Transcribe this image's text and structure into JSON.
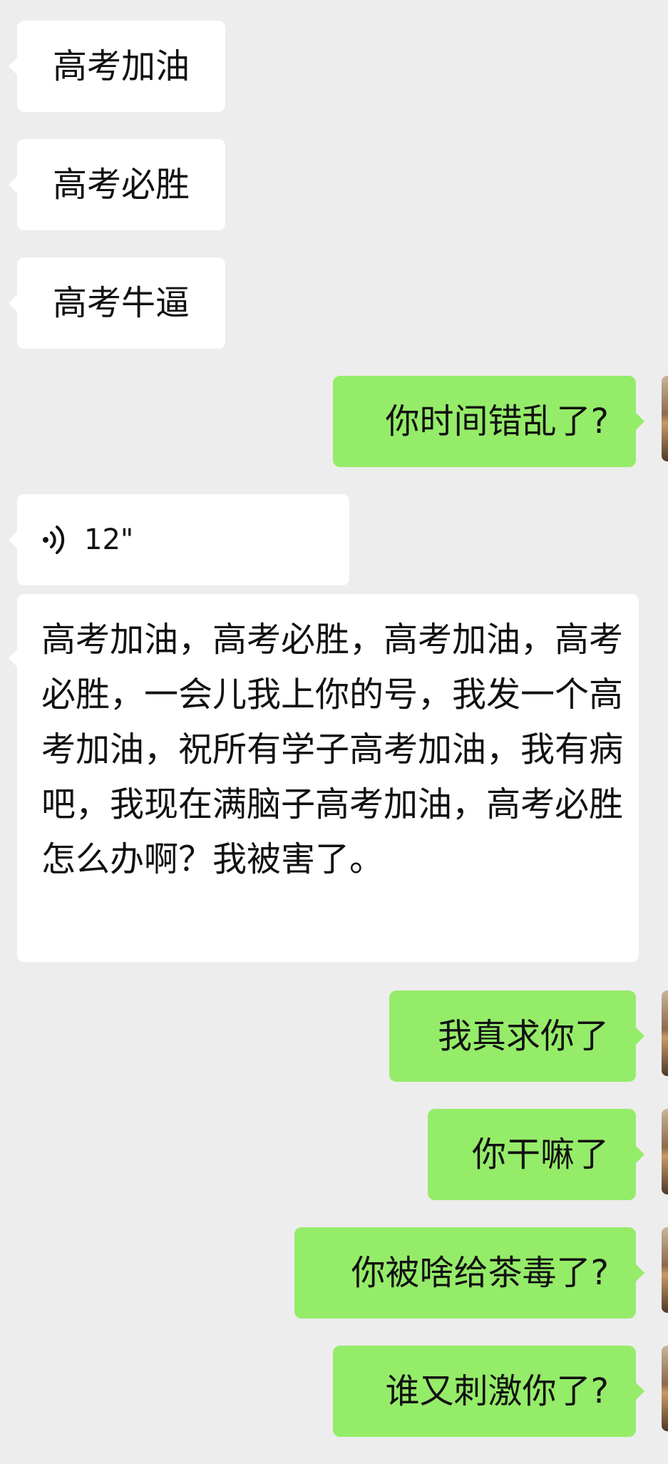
{
  "chat": {
    "messages": [
      {
        "sender": "other",
        "type": "text",
        "text": "高考加油"
      },
      {
        "sender": "other",
        "type": "text",
        "text": "高考必胜"
      },
      {
        "sender": "other",
        "type": "text",
        "text": "高考牛逼"
      },
      {
        "sender": "me",
        "type": "text",
        "text": "你时间错乱了?"
      },
      {
        "sender": "other",
        "type": "voice",
        "duration": "12\"",
        "icon": "voice-wave-icon"
      },
      {
        "sender": "other",
        "type": "text",
        "text": "高考加油，高考必胜，高考加油，高考必胜，一会儿我上你的号，我发一个高考加油，祝所有学子高考加油，我有病吧，我现在满脑子高考加油，高考必胜怎么办啊？我被害了。"
      },
      {
        "sender": "me",
        "type": "text",
        "text": "我真求你了"
      },
      {
        "sender": "me",
        "type": "text",
        "text": "你干嘛了"
      },
      {
        "sender": "me",
        "type": "text",
        "text": "你被啥给茶毒了?"
      },
      {
        "sender": "me",
        "type": "text",
        "text": "谁又刺激你了?"
      }
    ]
  },
  "colors": {
    "background": "#ededed",
    "incoming_bubble": "#ffffff",
    "outgoing_bubble": "#95ec69",
    "text": "#111111"
  }
}
